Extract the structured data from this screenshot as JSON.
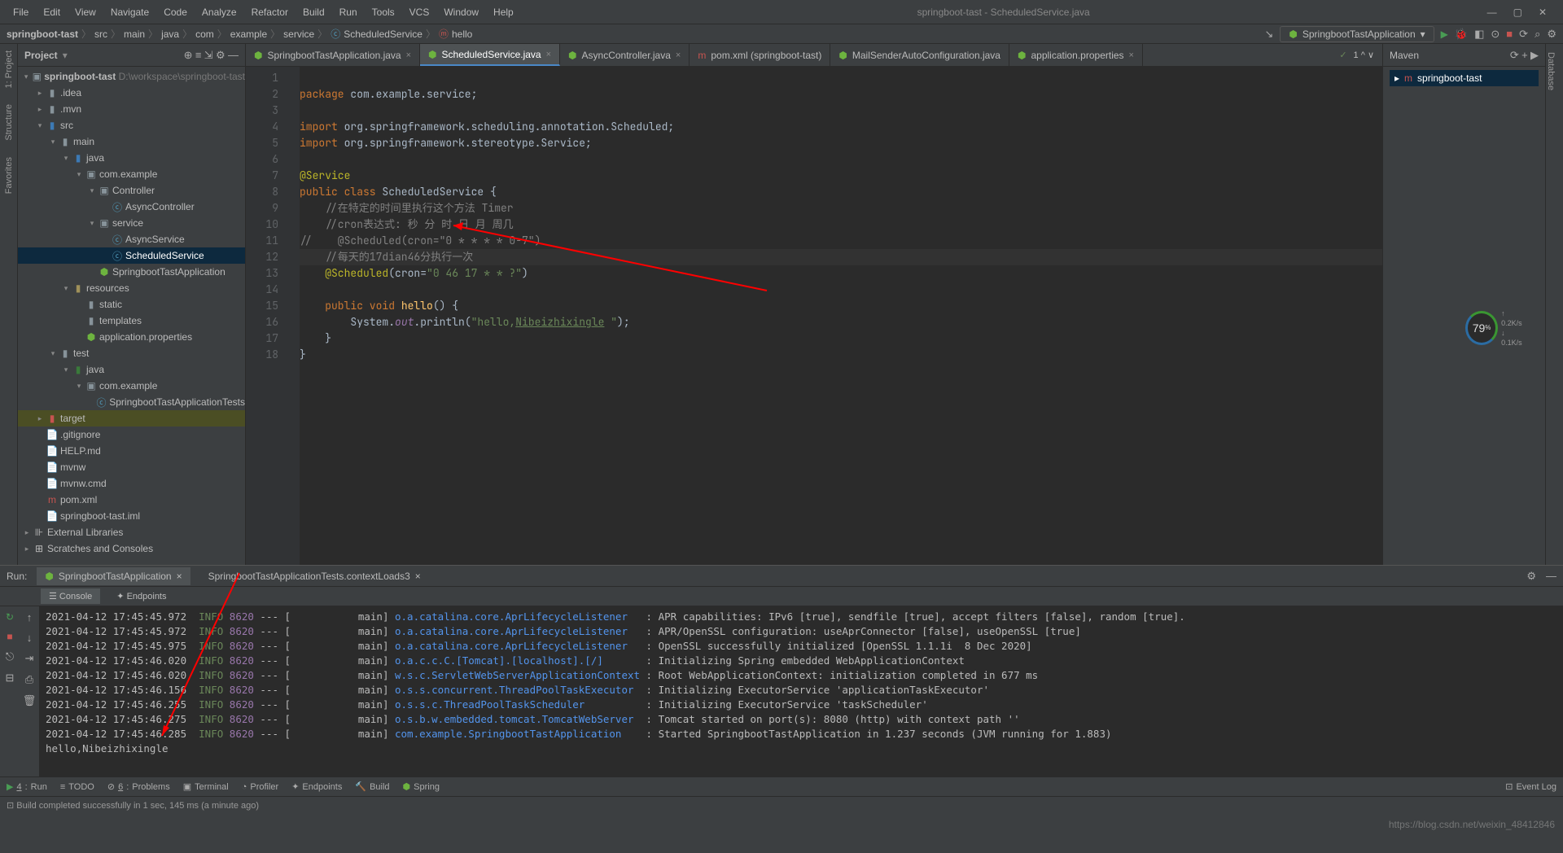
{
  "menus": [
    "File",
    "Edit",
    "View",
    "Navigate",
    "Code",
    "Analyze",
    "Refactor",
    "Build",
    "Run",
    "Tools",
    "VCS",
    "Window",
    "Help"
  ],
  "title": "springboot-tast - ScheduledService.java",
  "breadcrumbs": [
    "springboot-tast",
    "src",
    "main",
    "java",
    "com",
    "example",
    "service",
    "ScheduledService",
    "hello"
  ],
  "run_config": "SpringbootTastApplication",
  "project_panel": {
    "title": "Project"
  },
  "tree": {
    "root": "springboot-tast",
    "root_path": "D:\\workspace\\springboot-tast",
    "idea": ".idea",
    "mvn": ".mvn",
    "src": "src",
    "main": "main",
    "java": "java",
    "pkg": "com.example",
    "controller": "Controller",
    "async_ctrl": "AsyncController",
    "service": "service",
    "async_svc": "AsyncService",
    "sched_svc": "ScheduledService",
    "app_cls": "SpringbootTastApplication",
    "resources": "resources",
    "static": "static",
    "templates": "templates",
    "app_props": "application.properties",
    "test": "test",
    "test_java": "java",
    "test_pkg": "com.example",
    "test_cls": "SpringbootTastApplicationTests",
    "target": "target",
    "gitignore": ".gitignore",
    "help": "HELP.md",
    "mvnw": "mvnw",
    "mvnwcmd": "mvnw.cmd",
    "pom": "pom.xml",
    "iml": "springboot-tast.iml",
    "ext_lib": "External Libraries",
    "scratch": "Scratches and Consoles"
  },
  "editor_tabs": [
    {
      "label": "SpringbootTastApplication.java",
      "icon": "spring"
    },
    {
      "label": "ScheduledService.java",
      "icon": "spring",
      "active": true
    },
    {
      "label": "AsyncController.java",
      "icon": "spring"
    },
    {
      "label": "pom.xml (springboot-tast)",
      "icon": "maven"
    },
    {
      "label": "MailSenderAutoConfiguration.java",
      "icon": "spring"
    },
    {
      "label": "application.properties",
      "icon": "spring"
    }
  ],
  "inspection": "✓ 1 ^ ∨",
  "code_lines": {
    "l1": "package com.example.service;",
    "l3_kw": "import",
    "l3_rest": " org.springframework.scheduling.annotation.",
    "l3_cls": "Scheduled",
    "l3_end": ";",
    "l4_kw": "import",
    "l4_rest": " org.springframework.stereotype.",
    "l4_cls": "Service",
    "l4_end": ";",
    "l6": "@Service",
    "l7_kw": "public class ",
    "l7_cls": "ScheduledService ",
    "l7_b": "{",
    "l8": "    //在特定的时间里执行这个方法 Timer",
    "l9": "    //cron表达式: 秒 分 时 日 月 周几",
    "l10": "//    @Scheduled(cron=\"0 * * * * 0-7\")",
    "l11": "    //每天的17dian46分执行一次",
    "l12_a": "    ",
    "l12_ann": "@Scheduled",
    "l12_p": "(cron=",
    "l12_s": "\"0 46 17 * * ?\"",
    "l12_e": ")",
    "l14_a": "    ",
    "l14_kw": "public void ",
    "l14_fn": "hello",
    "l14_e": "() {",
    "l15_a": "        System.",
    "l15_f": "out",
    "l15_b": ".println(",
    "l15_s1": "\"hello,",
    "l15_lnk": "Nibeizhixingle",
    "l15_s2": " \"",
    "l15_e": ");",
    "l16": "    }",
    "l17": "}"
  },
  "maven_panel": {
    "title": "Maven",
    "item": "springboot-tast"
  },
  "run": {
    "label": "Run:",
    "tab1": "SpringbootTastApplication",
    "tab2": "SpringbootTastApplicationTests.contextLoads3",
    "sub_console": "Console",
    "sub_endpoints": "Endpoints"
  },
  "console_lines": [
    {
      "ts": "2021-04-12 17:45:45.972",
      "lvl": "INFO",
      "pid": "8620",
      "th": "main",
      "src": "o.a.catalina.core.AprLifecycleListener",
      "msg": "APR capabilities: IPv6 [true], sendfile [true], accept filters [false], random [true]."
    },
    {
      "ts": "2021-04-12 17:45:45.972",
      "lvl": "INFO",
      "pid": "8620",
      "th": "main",
      "src": "o.a.catalina.core.AprLifecycleListener",
      "msg": "APR/OpenSSL configuration: useAprConnector [false], useOpenSSL [true]"
    },
    {
      "ts": "2021-04-12 17:45:45.975",
      "lvl": "INFO",
      "pid": "8620",
      "th": "main",
      "src": "o.a.catalina.core.AprLifecycleListener",
      "msg": "OpenSSL successfully initialized [OpenSSL 1.1.1i  8 Dec 2020]"
    },
    {
      "ts": "2021-04-12 17:45:46.020",
      "lvl": "INFO",
      "pid": "8620",
      "th": "main",
      "src": "o.a.c.c.C.[Tomcat].[localhost].[/]",
      "msg": "Initializing Spring embedded WebApplicationContext"
    },
    {
      "ts": "2021-04-12 17:45:46.020",
      "lvl": "INFO",
      "pid": "8620",
      "th": "main",
      "src": "w.s.c.ServletWebServerApplicationContext",
      "msg": "Root WebApplicationContext: initialization completed in 677 ms"
    },
    {
      "ts": "2021-04-12 17:45:46.156",
      "lvl": "INFO",
      "pid": "8620",
      "th": "main",
      "src": "o.s.s.concurrent.ThreadPoolTaskExecutor",
      "msg": "Initializing ExecutorService 'applicationTaskExecutor'"
    },
    {
      "ts": "2021-04-12 17:45:46.255",
      "lvl": "INFO",
      "pid": "8620",
      "th": "main",
      "src": "o.s.s.c.ThreadPoolTaskScheduler",
      "msg": "Initializing ExecutorService 'taskScheduler'"
    },
    {
      "ts": "2021-04-12 17:45:46.275",
      "lvl": "INFO",
      "pid": "8620",
      "th": "main",
      "src": "o.s.b.w.embedded.tomcat.TomcatWebServer",
      "msg": "Tomcat started on port(s): 8080 (http) with context path ''"
    },
    {
      "ts": "2021-04-12 17:45:46.285",
      "lvl": "INFO",
      "pid": "8620",
      "th": "main",
      "src": "com.example.SpringbootTastApplication",
      "msg": "Started SpringbootTastApplication in 1.237 seconds (JVM running for 1.883)"
    }
  ],
  "console_final": "hello,Nibeizhixingle",
  "bottom_tabs": {
    "run": "Run",
    "todo": "TODO",
    "problems": "Problems",
    "terminal": "Terminal",
    "profiler": "Profiler",
    "endpoints": "Endpoints",
    "build": "Build",
    "spring": "Spring",
    "eventlog": "Event Log"
  },
  "status_msg": "Build completed successfully in 1 sec, 145 ms (a minute ago)",
  "watermark": "https://blog.csdn.net/weixin_48412846",
  "gauge": {
    "pct": "79",
    "unit": "%",
    "up": "↑ 0.2K/s",
    "down": "↓ 0.1K/s"
  }
}
